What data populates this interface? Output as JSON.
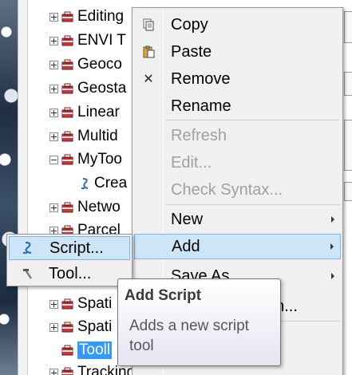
{
  "tree": {
    "rows": [
      {
        "label": "Editing",
        "expander": "plus",
        "icon": "toolbox-icon"
      },
      {
        "label": "ENVI T",
        "expander": "plus",
        "icon": "toolbox-icon"
      },
      {
        "label": "Geoco",
        "expander": "plus",
        "icon": "toolbox-icon"
      },
      {
        "label": "Geosta",
        "expander": "plus",
        "icon": "toolbox-icon"
      },
      {
        "label": "Linear",
        "expander": "plus",
        "icon": "toolbox-icon"
      },
      {
        "label": "Multid",
        "expander": "plus",
        "icon": "toolbox-icon"
      },
      {
        "label": "MyToo",
        "expander": "minus",
        "icon": "toolbox-icon"
      },
      {
        "label": "Crea",
        "expander": "none",
        "icon": "script-icon"
      },
      {
        "label": "Netwo",
        "expander": "plus",
        "icon": "toolbox-icon"
      },
      {
        "label": "Parcel",
        "expander": "plus",
        "icon": "toolbox-icon"
      },
      {
        "label": "Spati",
        "expander": "plus",
        "icon": "toolbox-icon"
      },
      {
        "label": "Spati",
        "expander": "plus",
        "icon": "toolbox-icon"
      },
      {
        "label": "Tooll",
        "expander": "none",
        "icon": "toolbox-icon",
        "selected": true
      },
      {
        "label": "Tracking Analyst Tools",
        "expander": "plus",
        "icon": "toolbox-icon"
      }
    ]
  },
  "context_menu": {
    "items": [
      {
        "label": "Copy",
        "icon": "copy-icon",
        "enabled": true
      },
      {
        "label": "Paste",
        "icon": "paste-icon",
        "enabled": true
      },
      {
        "label": "Remove",
        "icon": "remove-icon",
        "enabled": true
      },
      {
        "label": "Rename",
        "icon": "",
        "enabled": true
      },
      {
        "label": "Refresh",
        "icon": "",
        "enabled": false
      },
      {
        "label": "Edit...",
        "icon": "",
        "enabled": false
      },
      {
        "label": "Check Syntax...",
        "icon": "",
        "enabled": false
      },
      {
        "label": "New",
        "icon": "",
        "enabled": true,
        "submenu": true
      },
      {
        "label": "Add",
        "icon": "",
        "enabled": true,
        "submenu": true,
        "highlighted": true
      },
      {
        "label": "Save As",
        "icon": "",
        "enabled": true,
        "submenu": true
      },
      {
        "label": "on...",
        "icon": "",
        "enabled": true
      }
    ],
    "remove_glyph": "✕"
  },
  "add_submenu": {
    "items": [
      {
        "label": "Script...",
        "icon": "script-icon",
        "highlighted": true
      },
      {
        "label": "Tool...",
        "icon": "hammer-icon"
      }
    ]
  },
  "tooltip": {
    "title": "Add Script",
    "body": "Adds a new script tool"
  },
  "colors": {
    "menu_bg": "#f0f0f0",
    "highlight": "#cde6f7",
    "highlight_border": "#7eb4ea",
    "selection": "#3399ff",
    "disabled_text": "#a0a0a0"
  }
}
